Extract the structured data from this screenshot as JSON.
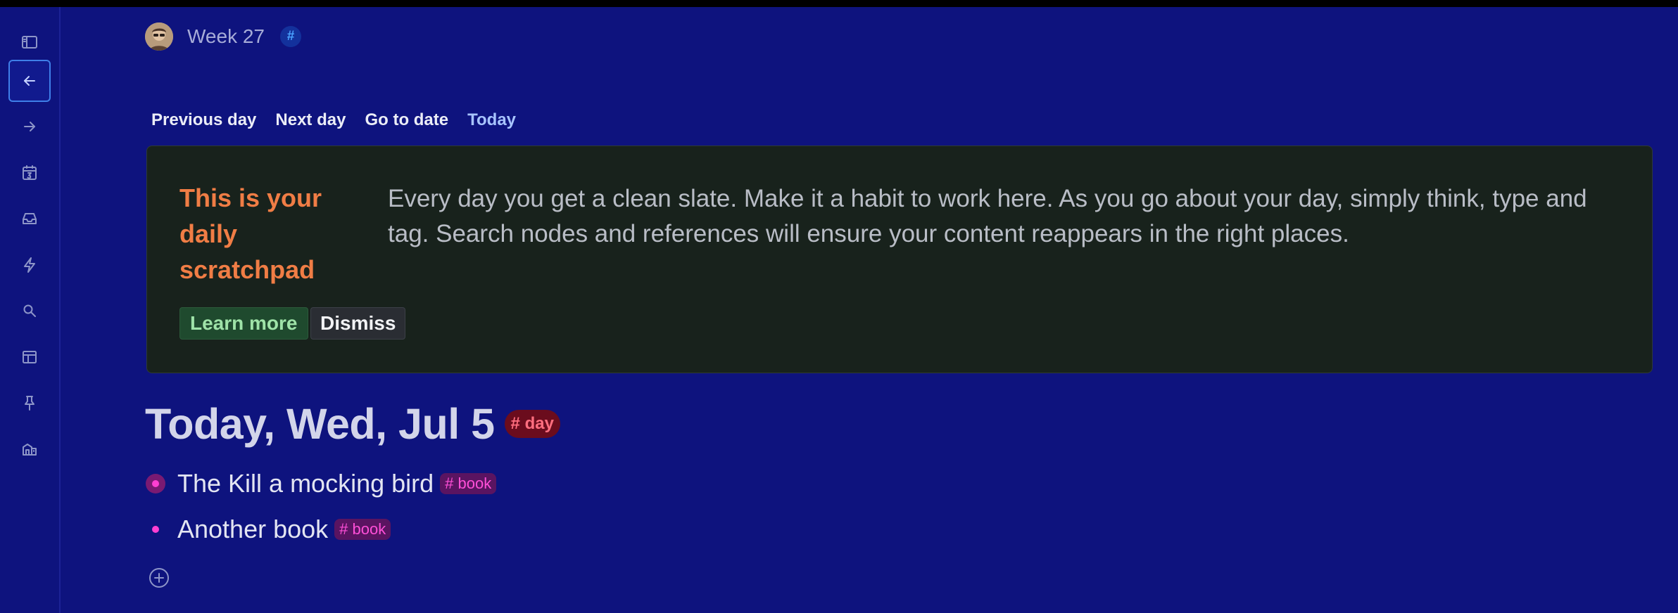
{
  "colors": {
    "background": "#0e137e",
    "accent": "#3f7fe8",
    "card_title": "#f07d45",
    "day_tag": "#ff6e7f",
    "book_tag": "#ff4fd8"
  },
  "sidebar": {
    "items": [
      {
        "icon": "sidebar-toggle-icon"
      },
      {
        "icon": "arrow-left-icon",
        "active": true
      },
      {
        "icon": "arrow-right-icon"
      },
      {
        "icon": "calendar-icon"
      },
      {
        "icon": "inbox-icon"
      },
      {
        "icon": "lightning-icon"
      },
      {
        "icon": "search-icon"
      },
      {
        "icon": "layout-icon"
      },
      {
        "icon": "pin-icon"
      },
      {
        "icon": "workspace-icon"
      }
    ]
  },
  "header": {
    "title": "Week 27",
    "hash_badge": "#"
  },
  "nav": {
    "previous": "Previous day",
    "next": "Next day",
    "go_to_date": "Go to date",
    "today": "Today"
  },
  "scratchpad": {
    "title": "This is your daily scratchpad",
    "body": "Every day you get a clean slate. Make it a habit to work here. As you go about your day, simply think, type and tag. Search nodes and references will ensure your content reappears in the right places.",
    "learn_more": "Learn more",
    "dismiss": "Dismiss"
  },
  "day": {
    "title": "Today, Wed, Jul 5",
    "tag": "# day"
  },
  "items": [
    {
      "text": "The Kill a mocking bird",
      "tag": "# book"
    },
    {
      "text": "Another book",
      "tag": "# book"
    }
  ]
}
